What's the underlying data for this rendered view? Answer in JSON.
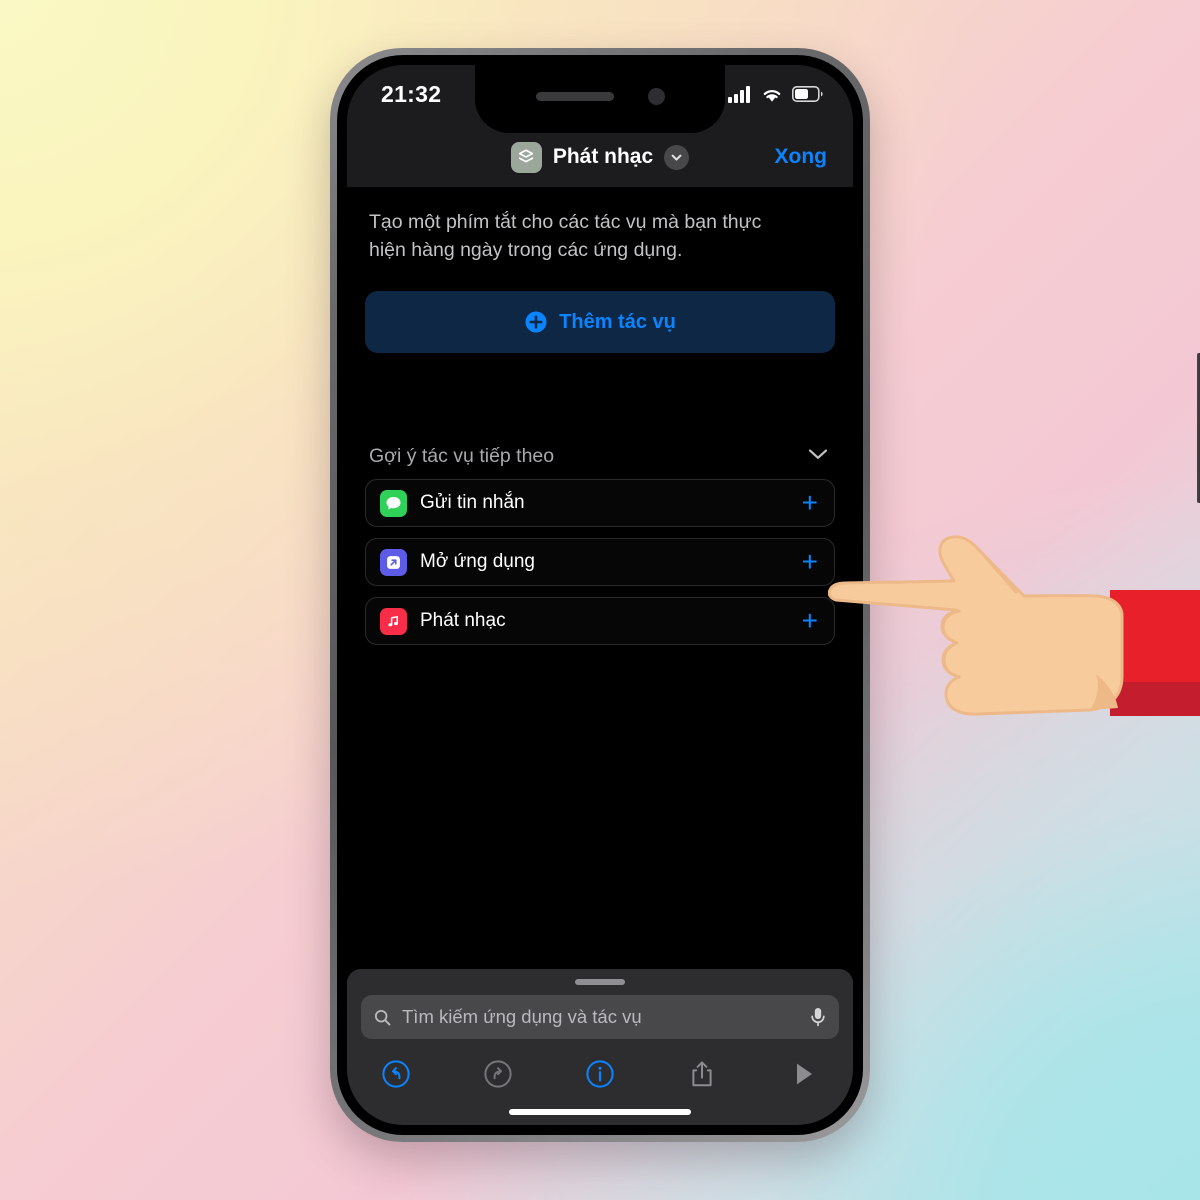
{
  "theme": {
    "accent_blue": "#0a84ff",
    "screen_bg": "#000000",
    "bar_bg": "#1c1c1e",
    "panel_bg": "#2d2d30",
    "add_button_bg": "#0d2744",
    "shortcut_icon_bg": "#9aa79a",
    "bg_gradient": [
      "#faf8c4",
      "#f7dcc4",
      "#f6cdd2",
      "#b3e5e8"
    ],
    "cuff_red": "#e8202a",
    "cuff_red_dark": "#c41e2e",
    "skin": "#f7c99b"
  },
  "status_bar": {
    "time": "21:32",
    "icons": {
      "cellular": "cellular-signal-icon",
      "wifi": "wifi-icon",
      "battery": "battery-icon"
    },
    "battery_level_percent": 55
  },
  "nav_bar": {
    "shortcut_icon": "shortcuts-layers-icon",
    "title": "Phát nhạc",
    "chevron_icon": "chevron-down-icon",
    "done_label": "Xong"
  },
  "main": {
    "description": "Tạo một phím tắt cho các tác vụ mà bạn thực hiện hàng ngày trong các ứng dụng.",
    "add_action": {
      "icon": "plus-circle-icon",
      "label": "Thêm tác vụ"
    },
    "suggestions": {
      "title": "Gợi ý tác vụ tiếp theo",
      "collapse_icon": "chevron-down-icon",
      "items": [
        {
          "label": "Gửi tin nhắn",
          "icon": "messages-icon",
          "icon_color": "#30d158",
          "add_icon": "plus-icon"
        },
        {
          "label": "Mở ứng dụng",
          "icon": "open-app-icon",
          "icon_color": "#5e5ce6",
          "add_icon": "plus-icon"
        },
        {
          "label": "Phát nhạc",
          "icon": "music-icon",
          "icon_color": "#fa2d48",
          "add_icon": "plus-icon"
        }
      ]
    }
  },
  "bottom": {
    "search": {
      "icon": "search-icon",
      "placeholder": "Tìm kiếm ứng dụng và tác vụ",
      "value": "",
      "mic_icon": "microphone-icon"
    },
    "toolbar": [
      {
        "name": "undo-button",
        "icon": "undo-icon",
        "enabled": true,
        "color": "#0a84ff"
      },
      {
        "name": "redo-button",
        "icon": "redo-icon",
        "enabled": false,
        "color": "#75757a"
      },
      {
        "name": "info-button",
        "icon": "info-icon",
        "enabled": true,
        "color": "#0a84ff"
      },
      {
        "name": "share-button",
        "icon": "share-icon",
        "enabled": false,
        "color": "#8b8b90"
      },
      {
        "name": "play-button",
        "icon": "play-icon",
        "enabled": false,
        "color": "#8b8b90"
      }
    ]
  },
  "annotation": {
    "pointer": "pointing-hand-icon",
    "target_label": "Phát nhạc"
  }
}
